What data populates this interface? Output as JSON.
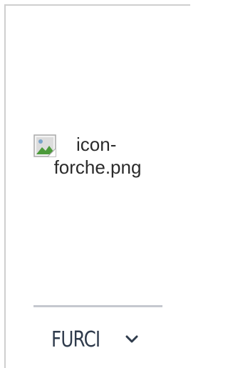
{
  "image": {
    "alt_text_line1": "icon-",
    "alt_text_line2": "forche.png"
  },
  "footer": {
    "toggle_label": "FURCI",
    "toggle_icon": "chevron-down-icon"
  },
  "colors": {
    "border": "#cfcfcf",
    "divider": "#c5c8cf",
    "label": "#2f3b4c",
    "alt_text": "#2b2b2b"
  }
}
